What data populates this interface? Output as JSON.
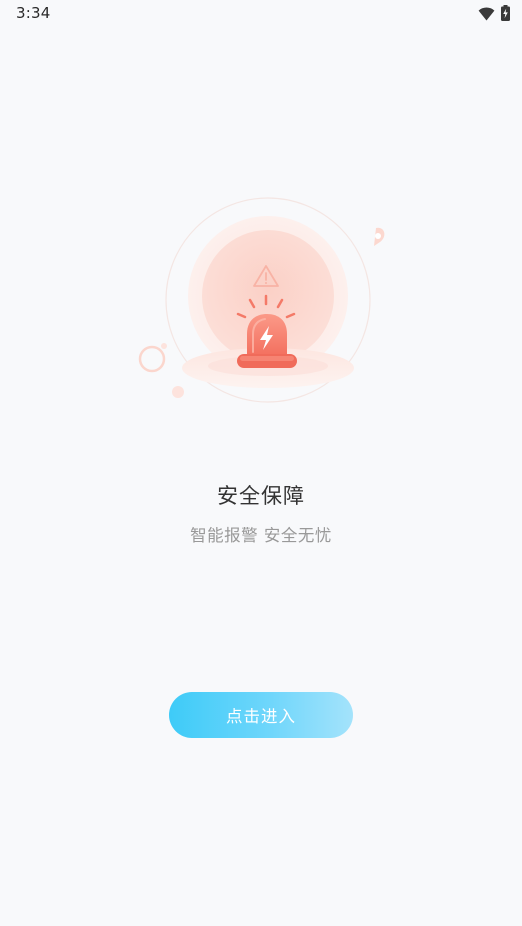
{
  "status_bar": {
    "time": "3:34",
    "icons": [
      "wifi-icon",
      "battery-charging-icon"
    ]
  },
  "illustration": {
    "icon": "siren-alarm-icon",
    "accent_color": "#f47a68"
  },
  "main": {
    "title": "安全保障",
    "subtitle": "智能报警 安全无忧"
  },
  "actions": {
    "enter_label": "点击进入",
    "enter_gradient": [
      "#3ecbf8",
      "#a4e3fb"
    ]
  }
}
